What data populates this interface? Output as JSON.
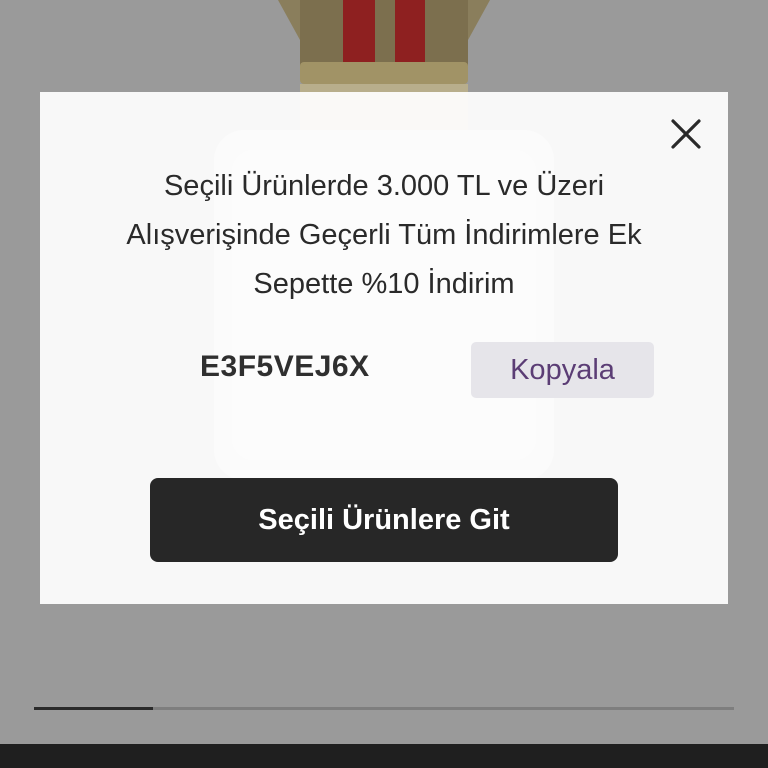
{
  "modal": {
    "lines": [
      "Seçili Ürünlerde 3.000 TL ve Üzeri",
      "Alışverişinde Geçerli Tüm İndirimlere Ek",
      "Sepette %10 İndirim"
    ],
    "coupon_code": "E3F5VEJ6X",
    "copy_label": "Kopyala",
    "cta_label": "Seçili Ürünlere Git",
    "close_icon": "close-icon"
  },
  "carousel": {
    "progress": 0.17
  },
  "colors": {
    "backdrop": "#9a9a9a",
    "cta": "#272727",
    "copy_text": "#5b3d75",
    "copy_bg": "#e6e5ea"
  }
}
